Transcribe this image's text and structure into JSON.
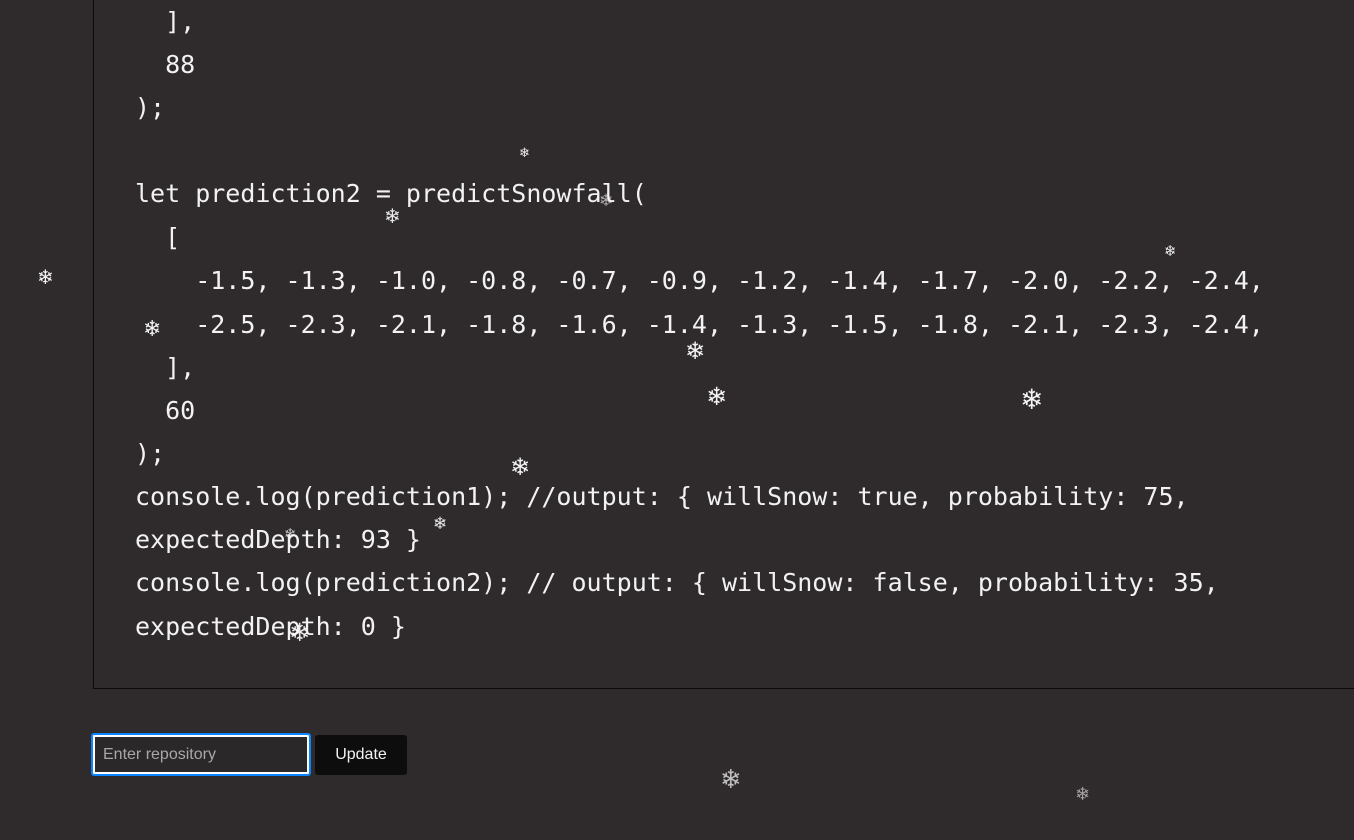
{
  "code": {
    "lines": [
      "  ],",
      "  88",
      ");",
      "",
      "let prediction2 = predictSnowfall(",
      "  [",
      "    -1.5, -1.3, -1.0, -0.8, -0.7, -0.9, -1.2, -1.4, -1.7, -2.0, -2.2, -2.4,",
      "    -2.5, -2.3, -2.1, -1.8, -1.6, -1.4, -1.3, -1.5, -1.8, -2.1, -2.3, -2.4,",
      "  ],",
      "  60",
      ");",
      "console.log(prediction1); //output: { willSnow: true, probability: 75,",
      "expectedDepth: 93 }",
      "console.log(prediction2); // output: { willSnow: false, probability: 35,",
      "expectedDepth: 0 }"
    ]
  },
  "repo_form": {
    "input_placeholder": "Enter repository",
    "input_value": "",
    "update_label": "Update"
  },
  "snowflake": {
    "glyph": "❄",
    "icon": "snowflake-icon",
    "color": "#ffffff"
  },
  "colors": {
    "background": "#2f2b2d",
    "code_text": "#f2f2f2",
    "input_focus": "#0a84ff",
    "button_bg": "#0e0d0e"
  }
}
